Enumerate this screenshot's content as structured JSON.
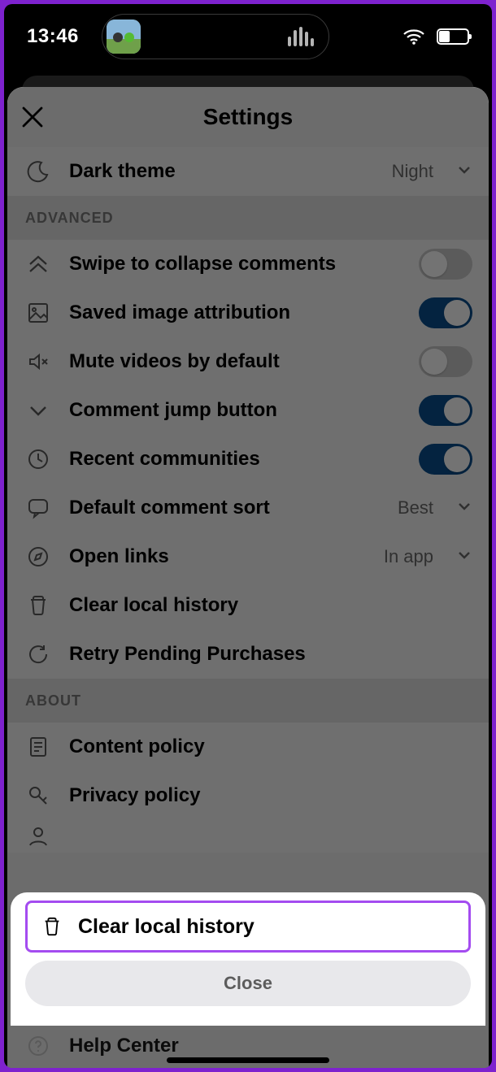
{
  "status": {
    "time": "13:46"
  },
  "header": {
    "title": "Settings"
  },
  "theme_row": {
    "label": "Dark theme",
    "value": "Night"
  },
  "sections": {
    "advanced": {
      "title": "ADVANCED",
      "rows": {
        "swipe": {
          "label": "Swipe to collapse comments",
          "on": false
        },
        "attrib": {
          "label": "Saved image attribution",
          "on": true
        },
        "mute": {
          "label": "Mute videos by default",
          "on": false
        },
        "jump": {
          "label": "Comment jump button",
          "on": true
        },
        "recent": {
          "label": "Recent communities",
          "on": true
        },
        "sort": {
          "label": "Default comment sort",
          "value": "Best"
        },
        "open": {
          "label": "Open links",
          "value": "In app"
        },
        "clear": {
          "label": "Clear local history"
        },
        "retry": {
          "label": "Retry Pending Purchases"
        }
      }
    },
    "about": {
      "title": "ABOUT",
      "rows": {
        "content": {
          "label": "Content policy"
        },
        "privacy": {
          "label": "Privacy policy"
        },
        "help": {
          "label": "Help Center"
        }
      }
    }
  },
  "sheet": {
    "option": "Clear local history",
    "close": "Close"
  }
}
